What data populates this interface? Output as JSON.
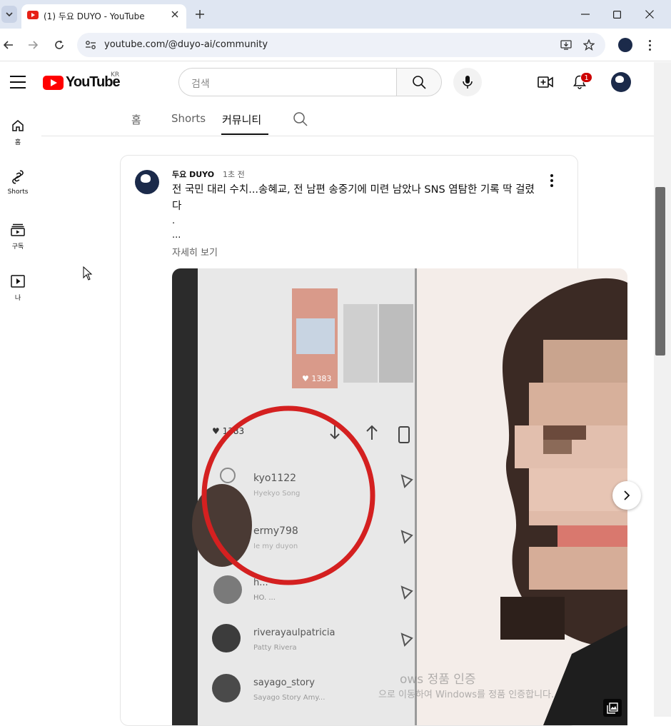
{
  "browser": {
    "tab_title": "(1) 두요 DUYO - YouTube",
    "url": "youtube.com/@duyo-ai/community"
  },
  "youtube": {
    "country_code": "KR",
    "logo_text": "YouTube",
    "search_placeholder": "검색",
    "notification_count": "1"
  },
  "guide": {
    "items": [
      {
        "label": "홈",
        "icon": "home-icon"
      },
      {
        "label": "Shorts",
        "icon": "shorts-icon"
      },
      {
        "label": "구독",
        "icon": "subscriptions-icon"
      },
      {
        "label": "나",
        "icon": "you-icon"
      }
    ]
  },
  "channel_tabs": {
    "items": [
      {
        "label": "홈",
        "active": false
      },
      {
        "label": "Shorts",
        "active": false
      },
      {
        "label": "커뮤니티",
        "active": true
      }
    ]
  },
  "post": {
    "author": "두요 DUYO",
    "time": "1초 전",
    "text": "전 국민 대리 수치...송혜교, 전 남편 송중기에 미련 남았나 SNS 염탐한 기록 딱 걸렸다",
    "line2": ".",
    "line3": "...",
    "read_more": "자세히 보기",
    "image": {
      "likes_thumb": "♥ 1383",
      "likes": "♥ 1383",
      "rows": [
        {
          "user": "kyo1122",
          "sub": "Hyekyo Song"
        },
        {
          "user": "ermy798",
          "sub": "Ie my duyon"
        },
        {
          "user": "h...",
          "sub": "HO. ..."
        },
        {
          "user": "riverayaulpatricia",
          "sub": "Patty Rivera"
        },
        {
          "user": "sayago_story",
          "sub": "Sayago Story Amy..."
        }
      ]
    }
  },
  "watermark": {
    "line1": "ows 정품 인증",
    "line2": "으로 이동하여 Windows를 정품 인증합니다."
  },
  "colors": {
    "yt_red": "#ff0000",
    "badge_red": "#cc0000",
    "highlight_circle": "#d42020"
  }
}
